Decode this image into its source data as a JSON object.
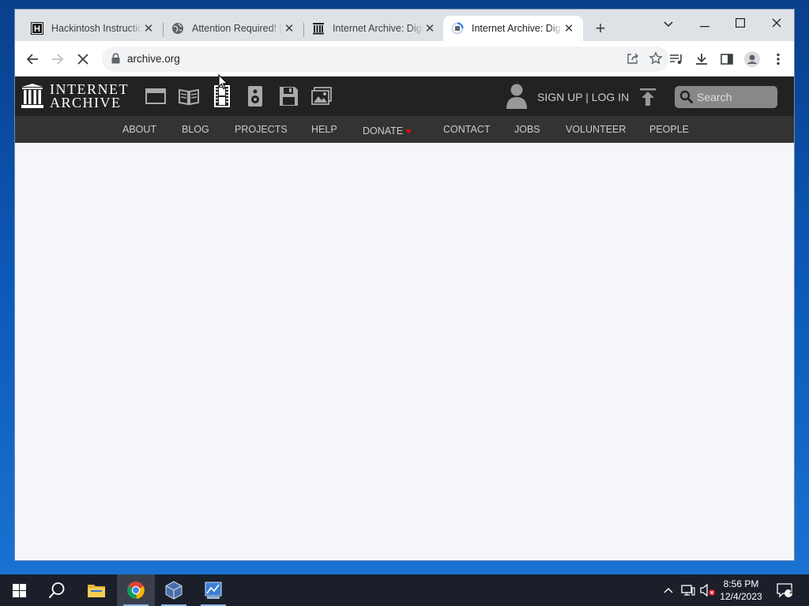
{
  "browser": {
    "tabs": [
      {
        "title": "Hackintosh Instructions",
        "favicon": "hackintosh-h-icon"
      },
      {
        "title": "Attention Required! | Cloudflare",
        "favicon": "globe-icon"
      },
      {
        "title": "Internet Archive: Digital Library",
        "favicon": "archive-temple-icon"
      },
      {
        "title": "Internet Archive: Digital Library",
        "favicon": "loading-spinner-icon",
        "active": true
      }
    ],
    "address": "archive.org",
    "colors": {
      "tabstrip": "#dee1e6",
      "toolbar": "#ffffff",
      "omnibox": "#f1f3f4"
    }
  },
  "ia": {
    "logo_line1": "INTERNET",
    "logo_line2": "ARCHIVE",
    "media_icons": [
      "web-icon",
      "texts-icon",
      "video-icon",
      "audio-icon",
      "software-icon",
      "images-icon"
    ],
    "signup": "SIGN UP | LOG IN",
    "search_placeholder": "Search",
    "nav": [
      "ABOUT",
      "BLOG",
      "PROJECTS",
      "HELP",
      "DONATE",
      "CONTACT",
      "JOBS",
      "VOLUNTEER",
      "PEOPLE"
    ],
    "colors": {
      "topbar": "#222222",
      "navbar": "#333333",
      "heart": "#ff0000"
    }
  },
  "taskbar": {
    "time": "8:56 PM",
    "date": "12/4/2023",
    "notification_count": "1",
    "apps": [
      "start-icon",
      "search-icon",
      "file-explorer-icon",
      "chrome-icon",
      "virtualbox-icon",
      "control-panel-icon"
    ]
  }
}
